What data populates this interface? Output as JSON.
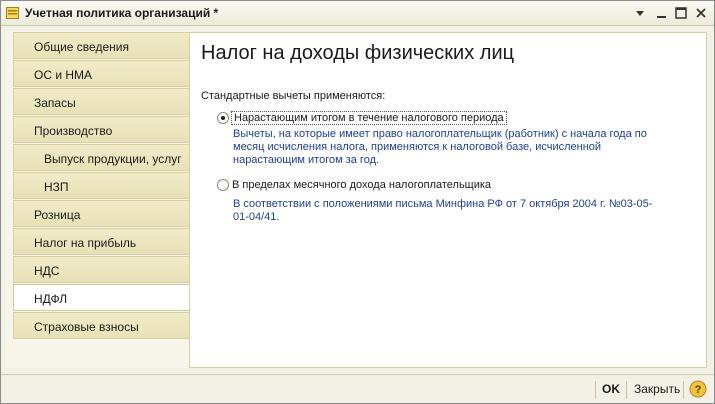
{
  "window": {
    "title": "Учетная политика организаций *"
  },
  "nav": {
    "items": [
      {
        "label": "Общие сведения"
      },
      {
        "label": "ОС и НМА"
      },
      {
        "label": "Запасы"
      },
      {
        "label": "Производство"
      },
      {
        "label": "Выпуск продукции, услуг"
      },
      {
        "label": "НЗП"
      },
      {
        "label": "Розница"
      },
      {
        "label": "Налог на прибыль"
      },
      {
        "label": "НДС"
      },
      {
        "label": "НДФЛ",
        "active": true
      },
      {
        "label": "Страховые взносы"
      }
    ]
  },
  "main": {
    "title": "Налог на доходы физических лиц",
    "subtitle": "Стандартные вычеты применяются:",
    "options": [
      {
        "label": "Нарастающим итогом в течение налогового периода",
        "selected": true,
        "description": "Вычеты, на которые имеет право налогоплательщик (работник) с начала года по месяц исчисления налога, применяются к налоговой базе, исчисленной нарастающим итогом за год."
      },
      {
        "label": "В пределах месячного дохода налогоплательщика",
        "selected": false,
        "description": "В соответствии с положениями письма Минфина РФ от 7 октября 2004 г. №03-05-01-04/41."
      }
    ]
  },
  "footer": {
    "ok_label": "OK",
    "close_label": "Закрыть"
  },
  "colors": {
    "nav_tab": "#eae4bd",
    "description_text": "#1f3f9c",
    "window_bg": "#f3f1e6"
  }
}
